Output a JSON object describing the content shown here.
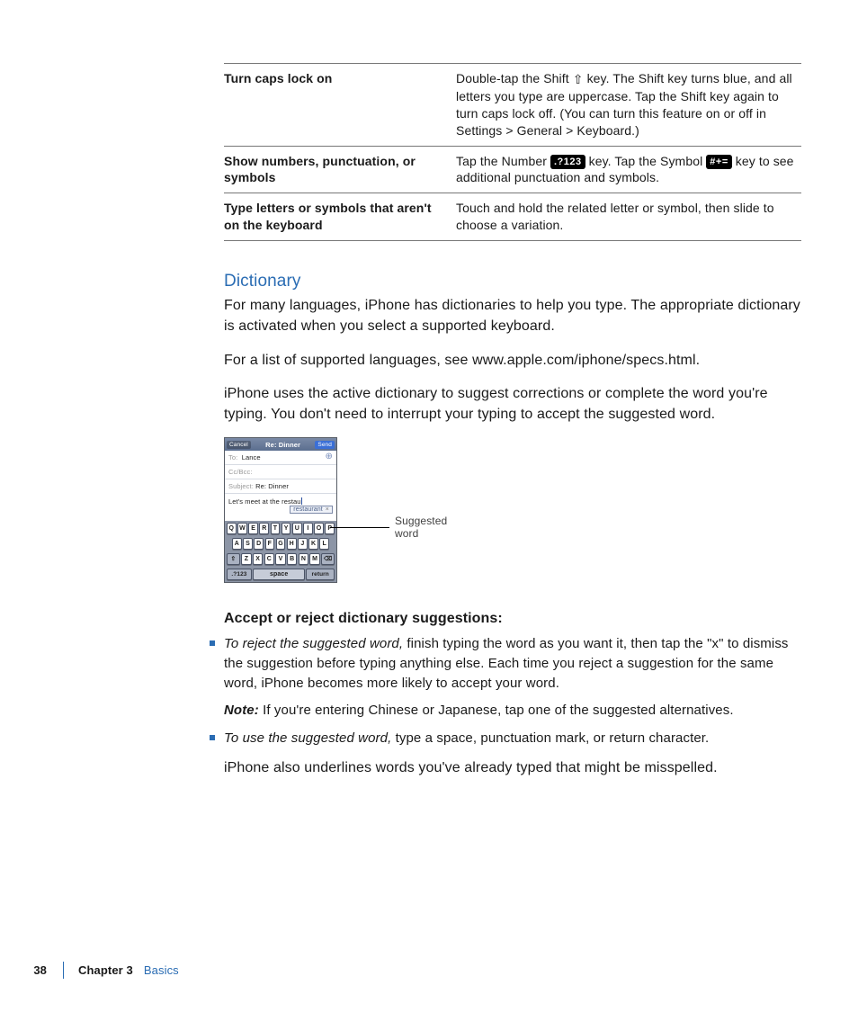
{
  "table": {
    "rows": [
      {
        "left": "Turn caps lock on",
        "right_segments": [
          {
            "t": "Double-tap the Shift "
          },
          {
            "icon": "shift"
          },
          {
            "t": " key. The Shift key turns blue, and all letters you type are uppercase. Tap the Shift key again to turn caps lock off. (You can turn this feature on or off in Settings > General > Keyboard.)"
          }
        ]
      },
      {
        "left": "Show numbers, punctuation, or symbols",
        "right_segments": [
          {
            "t": "Tap the Number "
          },
          {
            "icon": "num",
            "label": ".?123"
          },
          {
            "t": " key. Tap the Symbol "
          },
          {
            "icon": "sym",
            "label": "#+="
          },
          {
            "t": " key to see additional punctuation and symbols."
          }
        ]
      },
      {
        "left": "Type letters or symbols that aren't on the keyboard",
        "right_segments": [
          {
            "t": "Touch and hold the related letter or symbol, then slide to choose a variation."
          }
        ]
      }
    ]
  },
  "section_title": "Dictionary",
  "para1": "For many languages, iPhone has dictionaries to help you type. The appropriate dictionary is activated when you select a supported keyboard.",
  "para2": "For a list of supported languages, see www.apple.com/iphone/specs.html.",
  "para3": "iPhone uses the active dictionary to suggest corrections or complete the word you're typing. You don't need to interrupt your typing to accept the suggested word.",
  "phone": {
    "cancel": "Cancel",
    "title": "Re: Dinner",
    "send": "Send",
    "to_lbl": "To:",
    "to_val": "Lance",
    "cc_lbl": "Cc/Bcc:",
    "subj_lbl": "Subject:",
    "subj_val": "Re: Dinner",
    "body_text": "Let's meet at the restau",
    "suggestion": "restaurant",
    "row1": [
      "Q",
      "W",
      "E",
      "R",
      "T",
      "Y",
      "U",
      "I",
      "O",
      "P"
    ],
    "row2": [
      "A",
      "S",
      "D",
      "F",
      "G",
      "H",
      "J",
      "K",
      "L"
    ],
    "row3_shift": "⇧",
    "row3": [
      "Z",
      "X",
      "C",
      "V",
      "B",
      "N",
      "M"
    ],
    "row3_del": "⌫",
    "row4_num": ".?123",
    "row4_space": "space",
    "row4_ret": "return"
  },
  "callout_label": "Suggested word",
  "subhead": "Accept or reject dictionary suggestions:",
  "bullets": [
    {
      "lead_italic": "To reject the suggested word,",
      "rest": " finish typing the word as you want it, then tap the \"x\" to dismiss the suggestion before typing anything else. Each time you reject a suggestion for the same word, iPhone becomes more likely to accept your word.",
      "note_label": "Note:  ",
      "note_rest": "If you're entering Chinese or Japanese, tap one of the suggested alternatives."
    },
    {
      "lead_italic": "To use the suggested word,",
      "rest": " type a space, punctuation mark, or return character."
    }
  ],
  "after_bullets": "iPhone also underlines words you've already typed that might be misspelled.",
  "footer": {
    "page": "38",
    "chapter": "Chapter 3",
    "name": "Basics"
  }
}
